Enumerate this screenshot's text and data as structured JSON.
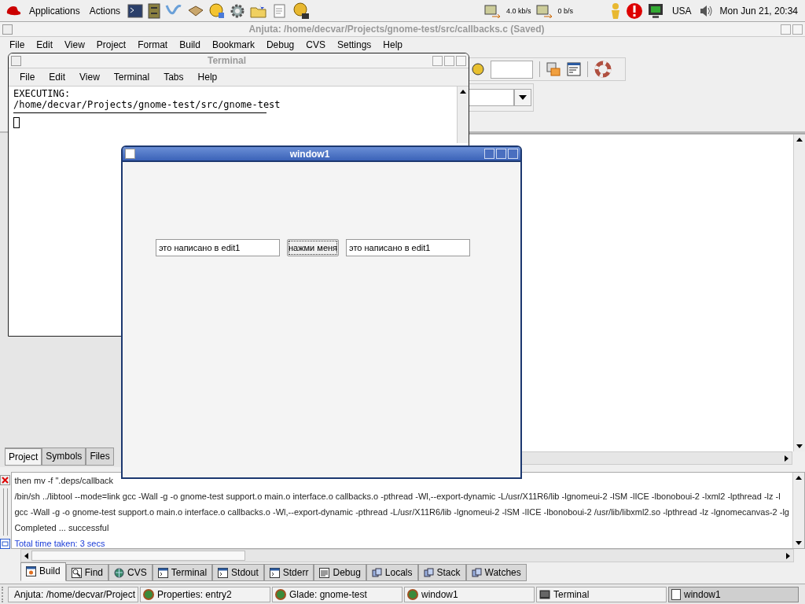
{
  "top_panel": {
    "menus": [
      "Applications",
      "Actions"
    ],
    "net_down": "4.0 kb/s",
    "net_up": "0 b/s",
    "keyboard": "USA",
    "clock": "Mon Jun 21, 20:34"
  },
  "anjuta": {
    "title": "Anjuta: /home/decvar/Projects/gnome-test/src/callbacks.c (Saved)",
    "active": false,
    "menu": [
      "File",
      "Edit",
      "View",
      "Project",
      "Format",
      "Build",
      "Bookmark",
      "Debug",
      "CVS",
      "Settings",
      "Help"
    ],
    "project_tabs": [
      {
        "label": "Project",
        "selected": true
      },
      {
        "label": "Symbols",
        "selected": false
      },
      {
        "label": "Files",
        "selected": false
      }
    ],
    "build_output": [
      {
        "text": "then mv -f \".deps/callback",
        "kind": "plain"
      },
      {
        "text": "/bin/sh ../libtool --mode=link gcc -Wall -g    -o gnome-test  support.o main.o interface.o callbacks.o -pthread -Wl,--export-dynamic -L/usr/X11R6/lib -lgnomeui-2 -lSM -lICE -lbonoboui-2 -lxml2 -lpthread -lz -l",
        "kind": "plain"
      },
      {
        "text": "gcc -Wall -g -o gnome-test support.o main.o interface.o callbacks.o -Wl,--export-dynamic  -pthread -L/usr/X11R6/lib -lgnomeui-2 -lSM -lICE -lbonoboui-2 /usr/lib/libxml2.so -lpthread -lz -lgnomecanvas-2 -lg",
        "kind": "plain"
      },
      {
        "text": "Completed ... successful",
        "kind": "plain"
      },
      {
        "text": "Total time taken: 3 secs",
        "kind": "info"
      }
    ],
    "output_tabs": [
      {
        "label": "Build",
        "selected": true
      },
      {
        "label": "Find",
        "selected": false
      },
      {
        "label": "CVS",
        "selected": false
      },
      {
        "label": "Terminal",
        "selected": false
      },
      {
        "label": "Stdout",
        "selected": false
      },
      {
        "label": "Stderr",
        "selected": false
      },
      {
        "label": "Debug",
        "selected": false
      },
      {
        "label": "Locals",
        "selected": false
      },
      {
        "label": "Stack",
        "selected": false
      },
      {
        "label": "Watches",
        "selected": false
      }
    ]
  },
  "terminal": {
    "title": "Terminal",
    "active": false,
    "menu": [
      "File",
      "Edit",
      "View",
      "Terminal",
      "Tabs",
      "Help"
    ],
    "lines": [
      "EXECUTING:",
      "/home/decvar/Projects/gnome-test/src/gnome-test"
    ]
  },
  "window1": {
    "title": "window1",
    "active": true,
    "field_left": "это написано в edit1",
    "button": "нажми меня",
    "field_right": "это написано в edit1"
  },
  "taskbar": [
    {
      "label": "Anjuta: /home/decvar/Project",
      "selected": false
    },
    {
      "label": "Properties: entry2",
      "selected": false
    },
    {
      "label": "Glade: gnome-test",
      "selected": false
    },
    {
      "label": "window1",
      "selected": false
    },
    {
      "label": "Terminal",
      "selected": false
    },
    {
      "label": "window1",
      "selected": true
    }
  ]
}
